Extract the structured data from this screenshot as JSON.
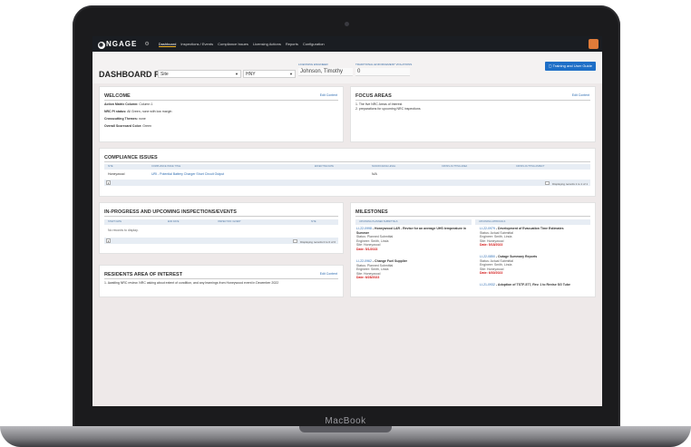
{
  "device": {
    "brand": "MacBook"
  },
  "nav": {
    "logo": "NGAGE",
    "items": [
      "Dashboard",
      "Inspections / Events",
      "Compliance Issues",
      "Licensing Actions",
      "Reports",
      "Configuration"
    ]
  },
  "header": {
    "title": "DASHBOARD FOR",
    "site_select": "Site",
    "unit_select": "HNY",
    "licensing_label": "LICENSING ENGINEER",
    "licensing_value": "Johnson, Timothy",
    "violations_label": "TRADITIONAL ENFORCEMENT VIOLATIONS",
    "violations_value": "0",
    "guide_button": "Training and User Guide"
  },
  "welcome": {
    "title": "WELCOME",
    "edit": "Edit Content",
    "lines": [
      {
        "label": "Action Matrix Column:",
        "value": "Column 1"
      },
      {
        "label": "NRC PI status:",
        "value": "All Green, none with low margin"
      },
      {
        "label": "Crosscutting Themes:",
        "value": "none"
      },
      {
        "label": "Overall Scorecard Color:",
        "value": "Green"
      }
    ]
  },
  "focus": {
    "title": "FOCUS AREAS",
    "edit": "Edit Content",
    "items": [
      "1. The five NRC Areas of Interest",
      "2. preparations for upcoming NRC inspections"
    ]
  },
  "compliance": {
    "title": "COMPLIANCE ISSUES",
    "columns": [
      "Site",
      "Compliance Issue Title",
      "Effective Date",
      "Significance Level",
      "Cross-Cutting Area",
      "Cross-Cutting Aspect"
    ],
    "rows": [
      [
        "Honeywood",
        "URI - Potential Battery Charger Short Circuit Output",
        "",
        "N/A",
        "",
        ""
      ]
    ],
    "pager_button": "1",
    "pager_info": "Displaying records 1 to 1 of 1"
  },
  "inspections": {
    "title": "IN-PROGRESS AND UPCOMING INSPECTIONS/EVENTS",
    "columns": [
      "Start Date",
      "End Date",
      "Inspection / Event",
      "Site"
    ],
    "empty": "No records to display.",
    "pager_button": "1",
    "pager_info": "Displaying records 0 to 0 of 0"
  },
  "residents": {
    "title": "RESIDENTS AREA OF INTEREST",
    "edit": "Edit Content",
    "items": [
      "1. Awaiting NRC review. NRC asking about extent of condition, and any learnings from Honeywood event in December 2022"
    ]
  },
  "milestones": {
    "title": "MILESTONES",
    "col1_header": "Upcoming Planned Submittals",
    "col2_header": "Upcoming Approvals",
    "col1": [
      {
        "title_link": "LI-22-0998",
        "title_text": " - Honeywood LAR - Revise for an average UHS temperature in Summer",
        "status": "Status: Planned Submittal",
        "engineer": "Engineer: Smith, Linda",
        "site": "Site: Honeywood",
        "date": "Date: 5/1/2023"
      },
      {
        "title_link": "LI-22-0962",
        "title_text": " - Change Fuel Supplier",
        "status": "Status: Planned Submittal",
        "engineer": "Engineer: Smith, Linda",
        "site": "Site: Honeywood",
        "date": "Date: 6/28/2023"
      }
    ],
    "col2": [
      {
        "title_link": "LI-22-0979",
        "title_text": " - Development of Evacuation Time Estimates",
        "status": "Status: Actual Submittal",
        "engineer": "Engineer: Smith, Linda",
        "site": "Site: Honeywood",
        "date": "Date: 5/18/2023"
      },
      {
        "title_link": "LI-22-0850",
        "title_text": " - Outage Summary Reports",
        "status": "Status: Actual Submittal",
        "engineer": "Engineer: Smith, Linda",
        "site": "Site: Honeywood",
        "date": "Date: 6/30/2023"
      },
      {
        "title_link": "LI-21-0932",
        "title_text": " - Adoption of TSTF-577, Rev. 1 to Revise SG Tube",
        "status": "",
        "engineer": "",
        "site": "",
        "date": ""
      }
    ]
  }
}
